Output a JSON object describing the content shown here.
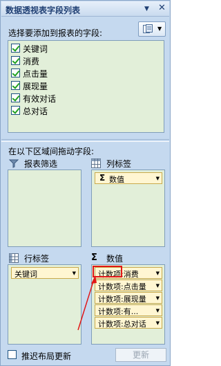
{
  "title": "数据透视表字段列表",
  "top_prompt": "选择要添加到报表的字段:",
  "fields": [
    {
      "label": "关键词",
      "checked": true
    },
    {
      "label": "消费",
      "checked": true
    },
    {
      "label": "点击量",
      "checked": true
    },
    {
      "label": "展现量",
      "checked": true
    },
    {
      "label": "有效对话",
      "checked": true
    },
    {
      "label": "总对话",
      "checked": true
    }
  ],
  "areas_prompt": "在以下区域间拖动字段:",
  "areas": {
    "report_filter": {
      "label": "报表筛选",
      "icon": "filter-icon"
    },
    "column_labels": {
      "label": "列标签",
      "icon": "column-grid-icon",
      "items": [
        "数值"
      ]
    },
    "row_labels": {
      "label": "行标签",
      "icon": "row-grid-icon",
      "items": [
        "关键词"
      ]
    },
    "values": {
      "label": "数值",
      "icon": "sigma-icon",
      "items": [
        "计数项:消费",
        "计数项:点击量",
        "计数项:展现量",
        "计数项:有...",
        "计数项:总对话"
      ]
    }
  },
  "defer_update_label": "推迟布局更新",
  "update_label": "更新",
  "colors": {
    "panel_bg": "#c5d9ef",
    "list_bg": "#e2efd9",
    "pill_bg": "#fff6d2",
    "highlight": "#e11717",
    "title_text": "#1f3f73"
  }
}
